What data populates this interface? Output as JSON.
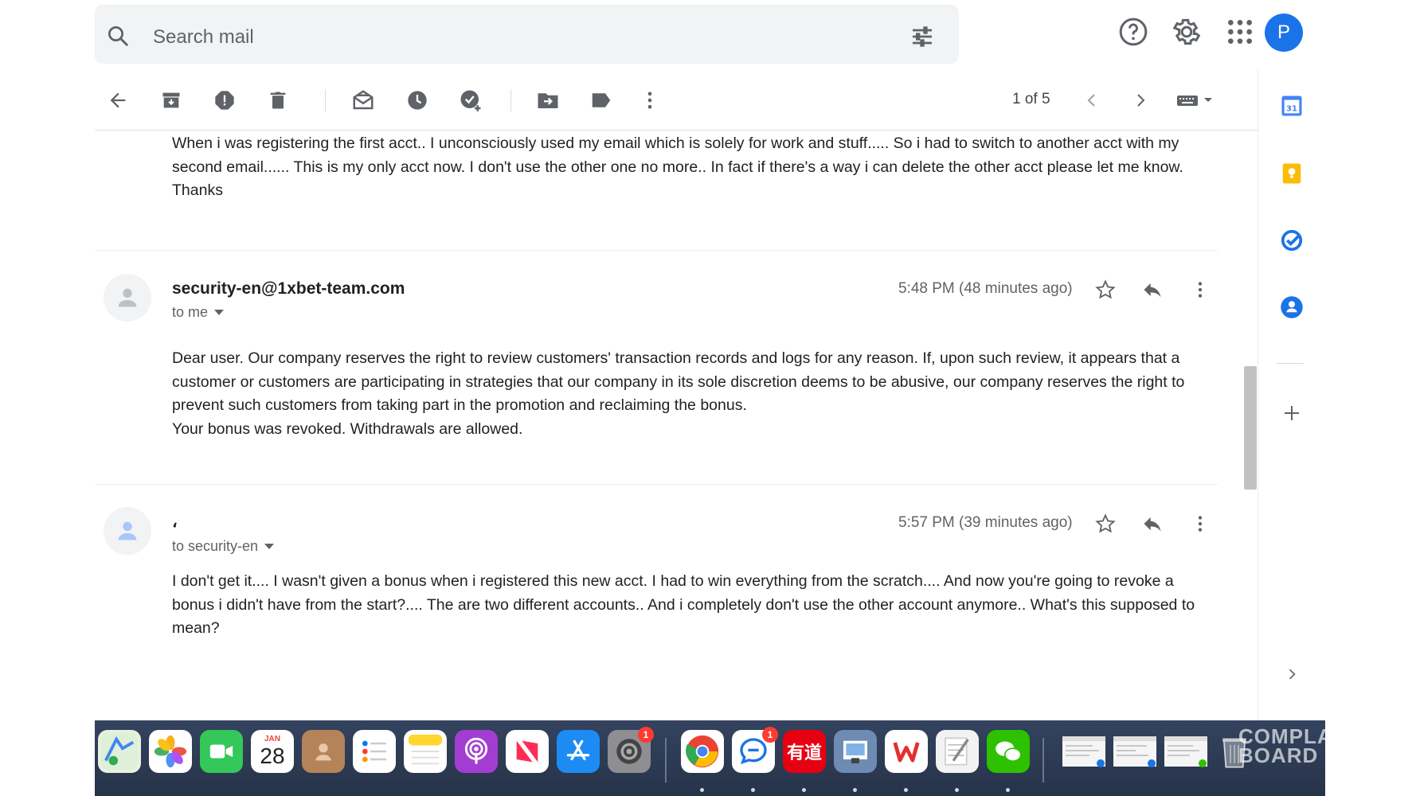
{
  "search": {
    "placeholder": "Search mail"
  },
  "header": {
    "avatar_letter": "P"
  },
  "toolbar": {
    "pager": "1 of 5"
  },
  "messages": [
    {
      "body_lines": [
        "When i was registering the first acct.. I unconsciously used my email which is solely for work and stuff..... So i had to switch to another acct with my",
        "second email...... This is my only acct now. I don't use the other one no more.. In fact if there's a way i can delete the other acct please let me know.",
        "Thanks"
      ]
    },
    {
      "sender": "security-en@1xbet-team.com",
      "recipient": "to me",
      "timestamp": "5:48 PM (48 minutes ago)",
      "body_lines": [
        "Dear user. Our company reserves the right to review customers' transaction records and logs for any reason. If, upon such review, it appears that a",
        "customer or customers are participating in strategies that our company in its sole discretion deems to be abusive, our company reserves the right to",
        "prevent such customers from taking part in the promotion and reclaiming the bonus.",
        "Your bonus was revoked. Withdrawals are allowed."
      ]
    },
    {
      "sender": "،",
      "recipient": "to security-en",
      "timestamp": "5:57 PM (39 minutes ago)",
      "body_lines": [
        "I don't get it.... I wasn't given a bonus when i registered this new acct. I had to win everything from the scratch.... And now you're going to revoke a",
        "bonus i didn't have from the start?.... The are two different accounts.. And i completely don't use the other account anymore.. What's this supposed to",
        "mean?"
      ]
    }
  ],
  "dock": {
    "calendar_month": "JAN",
    "calendar_day": "28",
    "youdao_label": "有道",
    "system_settings_badge": "1",
    "messages_badge": "1",
    "watermark_line1": "COMPLA",
    "watermark_line2": "BOARD"
  },
  "colors": {
    "accent": "#1a73e8",
    "dock": "#2b3a55"
  }
}
